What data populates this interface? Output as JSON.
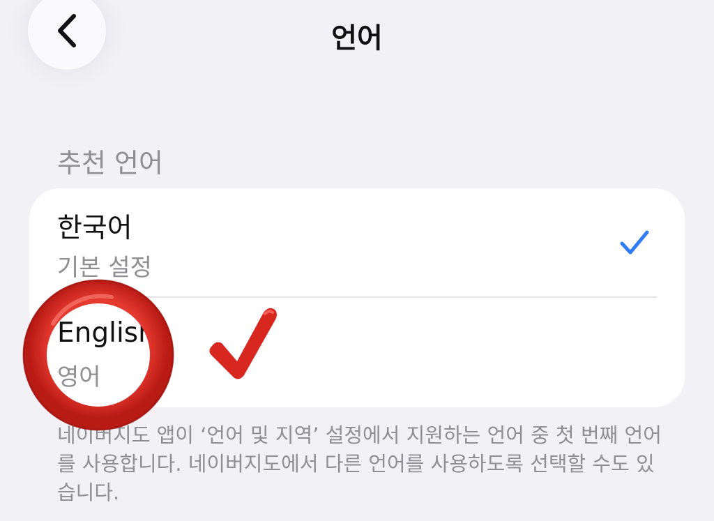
{
  "nav": {
    "title": "언어",
    "back_icon": "chevron-left-icon"
  },
  "section": {
    "header": "추천 언어"
  },
  "languages": [
    {
      "name": "한국어",
      "subtitle": "기본 설정",
      "selected": true
    },
    {
      "name": "English",
      "subtitle": "영어",
      "selected": false
    }
  ],
  "footer": {
    "note": "네이버지도 앱이 ‘언어 및 지역’ 설정에서 지원하는 언어 중 첫 번째 언어를 사용합니다. 네이버지도에서 다른 언어를 사용하도록 선택할 수도 있습니다."
  },
  "colors": {
    "background": "#f2f1f6",
    "card": "#ffffff",
    "accent": "#2f7cf6",
    "secondary_text": "#8e8e93",
    "annotation_red": "#d8271f"
  },
  "annotations": {
    "circle_icon": "red-circle-highlight",
    "check_icon": "red-check-mark"
  }
}
